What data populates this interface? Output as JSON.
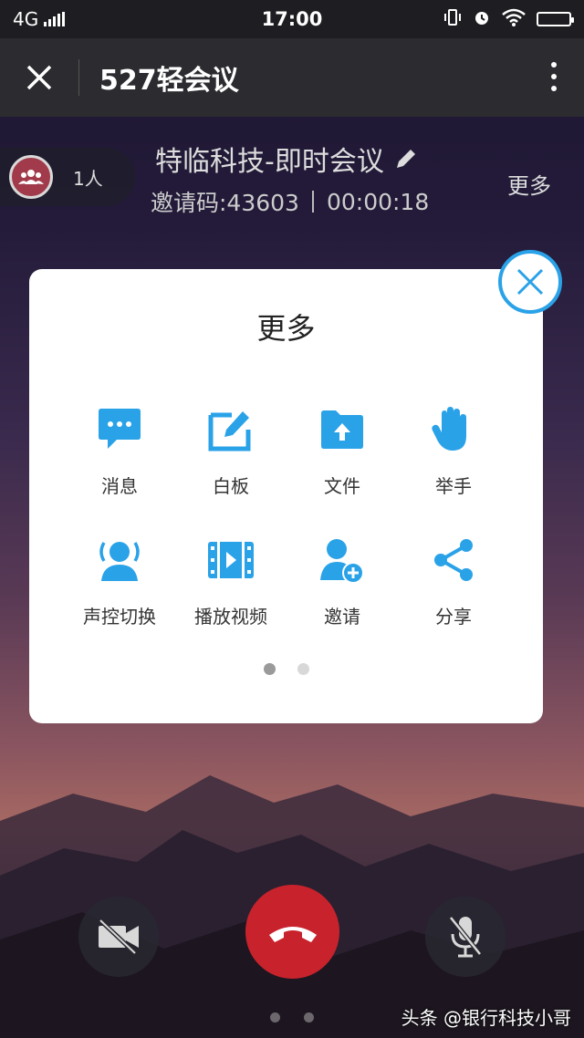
{
  "status_bar": {
    "network": "4G",
    "time": "17:00"
  },
  "header": {
    "title": "527轻会议"
  },
  "meeting": {
    "participants": "1人",
    "name": "特临科技-即时会议",
    "invite_code": "邀请码:43603",
    "duration": "00:00:18",
    "more_label": "更多"
  },
  "dialog": {
    "title": "更多",
    "items": [
      {
        "label": "消息",
        "icon": "message-icon"
      },
      {
        "label": "白板",
        "icon": "whiteboard-icon"
      },
      {
        "label": "文件",
        "icon": "file-upload-icon"
      },
      {
        "label": "举手",
        "icon": "raise-hand-icon"
      },
      {
        "label": "声控切换",
        "icon": "voice-switch-icon"
      },
      {
        "label": "播放视频",
        "icon": "play-video-icon"
      },
      {
        "label": "邀请",
        "icon": "invite-user-icon"
      },
      {
        "label": "分享",
        "icon": "share-icon"
      }
    ],
    "page_count": 2,
    "active_page": 1,
    "colors": {
      "icon": "#2aa2e8",
      "page_active": "#9a9a9a",
      "page_inactive": "#d8d8d8"
    }
  },
  "controls": {
    "camera": "camera-off-icon",
    "hangup": "hang-up-icon",
    "mic": "mic-off-icon",
    "hangup_color": "#c8232c"
  },
  "watermark": "头条 @银行科技小哥"
}
